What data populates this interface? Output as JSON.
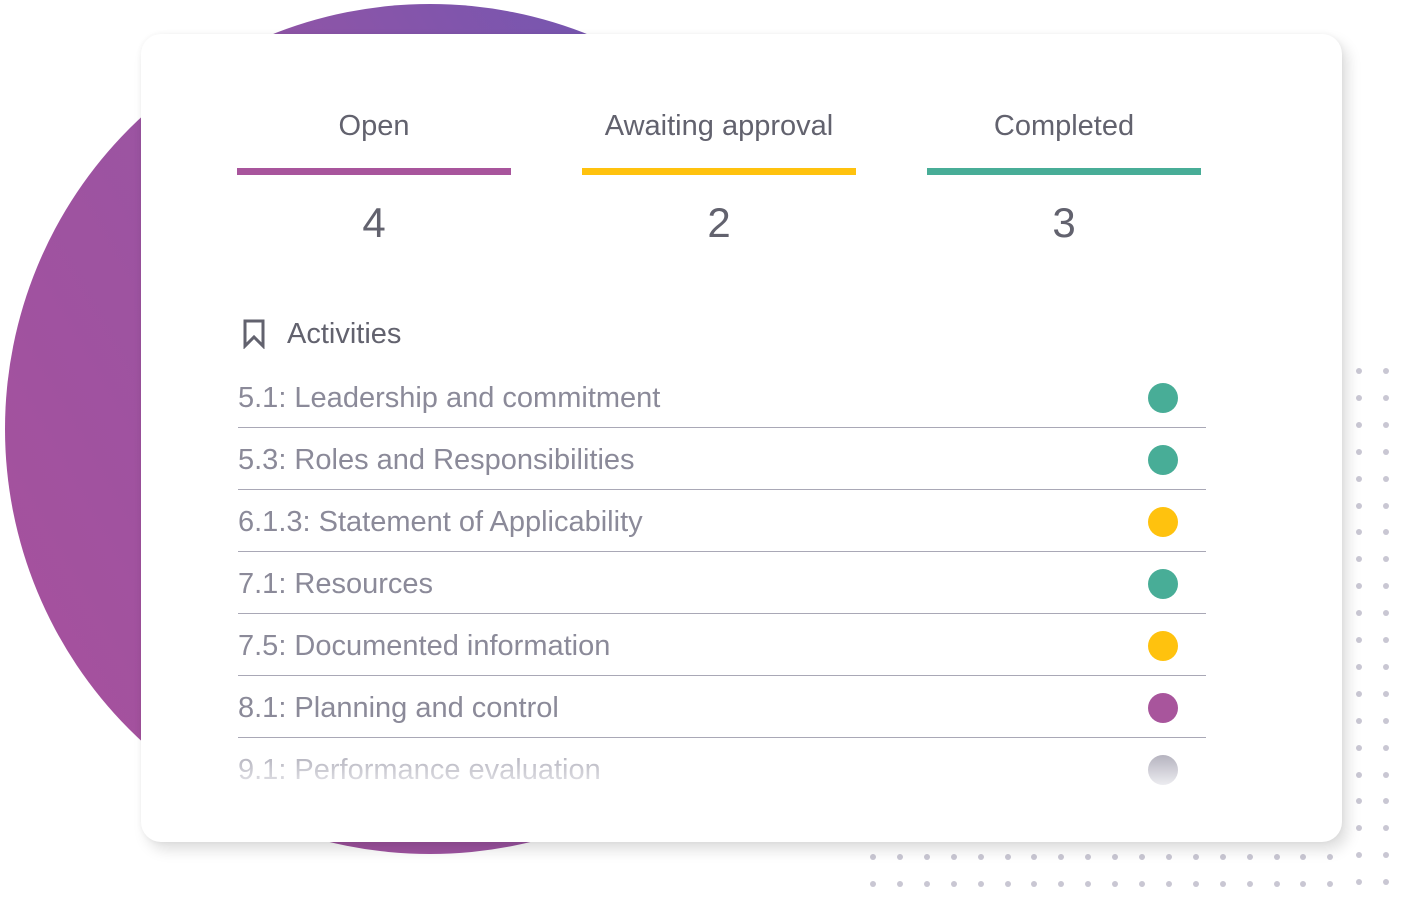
{
  "colors": {
    "open": "#a8559c",
    "awaiting": "#ffc20e",
    "completed": "#48ad97",
    "inactive": "#c3c2cc"
  },
  "stats": [
    {
      "label": "Open",
      "value": "4",
      "status": "open"
    },
    {
      "label": "Awaiting approval",
      "value": "2",
      "status": "awaiting"
    },
    {
      "label": "Completed",
      "value": "3",
      "status": "completed"
    }
  ],
  "activities": {
    "icon": "bookmark-icon",
    "title": "Activities",
    "items": [
      {
        "label": "5.1: Leadership and commitment",
        "status": "completed"
      },
      {
        "label": "5.3: Roles and Responsibilities",
        "status": "completed"
      },
      {
        "label": "6.1.3: Statement of Applicability",
        "status": "awaiting"
      },
      {
        "label": "7.1: Resources",
        "status": "completed"
      },
      {
        "label": "7.5: Documented information",
        "status": "awaiting"
      },
      {
        "label": "8.1: Planning and control",
        "status": "open"
      },
      {
        "label": "9.1: Performance evaluation",
        "status": "inactive"
      }
    ]
  }
}
